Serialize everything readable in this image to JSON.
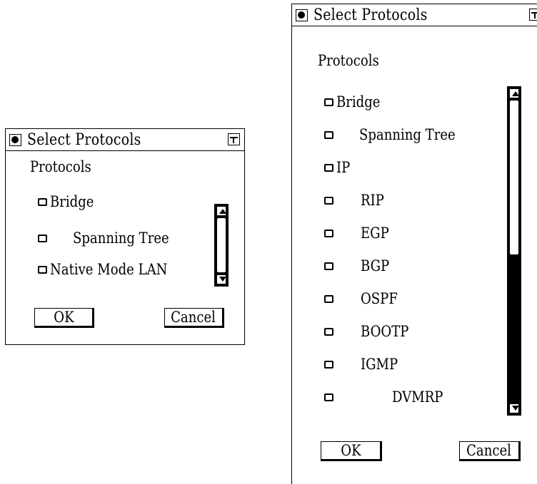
{
  "small_dialog": {
    "title": "Select Protocols",
    "section_label": "Protocols",
    "items": [
      {
        "label": "Bridge",
        "checked": false
      },
      {
        "label": "Spanning Tree",
        "checked": false
      },
      {
        "label": "Native Mode LAN",
        "checked": false
      }
    ],
    "ok_label": "OK",
    "cancel_label": "Cancel"
  },
  "large_dialog": {
    "title": "Select Protocols",
    "section_label": "Protocols",
    "items": [
      {
        "label": "Bridge",
        "checked": false
      },
      {
        "label": "Spanning Tree",
        "checked": false
      },
      {
        "label": "IP",
        "checked": false
      },
      {
        "label": "RIP",
        "checked": false
      },
      {
        "label": "EGP",
        "checked": false
      },
      {
        "label": "BGP",
        "checked": false
      },
      {
        "label": "OSPF",
        "checked": false
      },
      {
        "label": "BOOTP",
        "checked": false
      },
      {
        "label": "IGMP",
        "checked": false
      },
      {
        "label": "DVMRP",
        "checked": false
      }
    ],
    "ok_label": "OK",
    "cancel_label": "Cancel"
  },
  "icons": {
    "window_menu": "window-menu-icon",
    "maximize": "maximize-icon",
    "checkbox": "checkbox-icon",
    "scroll_up": "arrow-up-icon",
    "scroll_down": "arrow-down-icon"
  }
}
